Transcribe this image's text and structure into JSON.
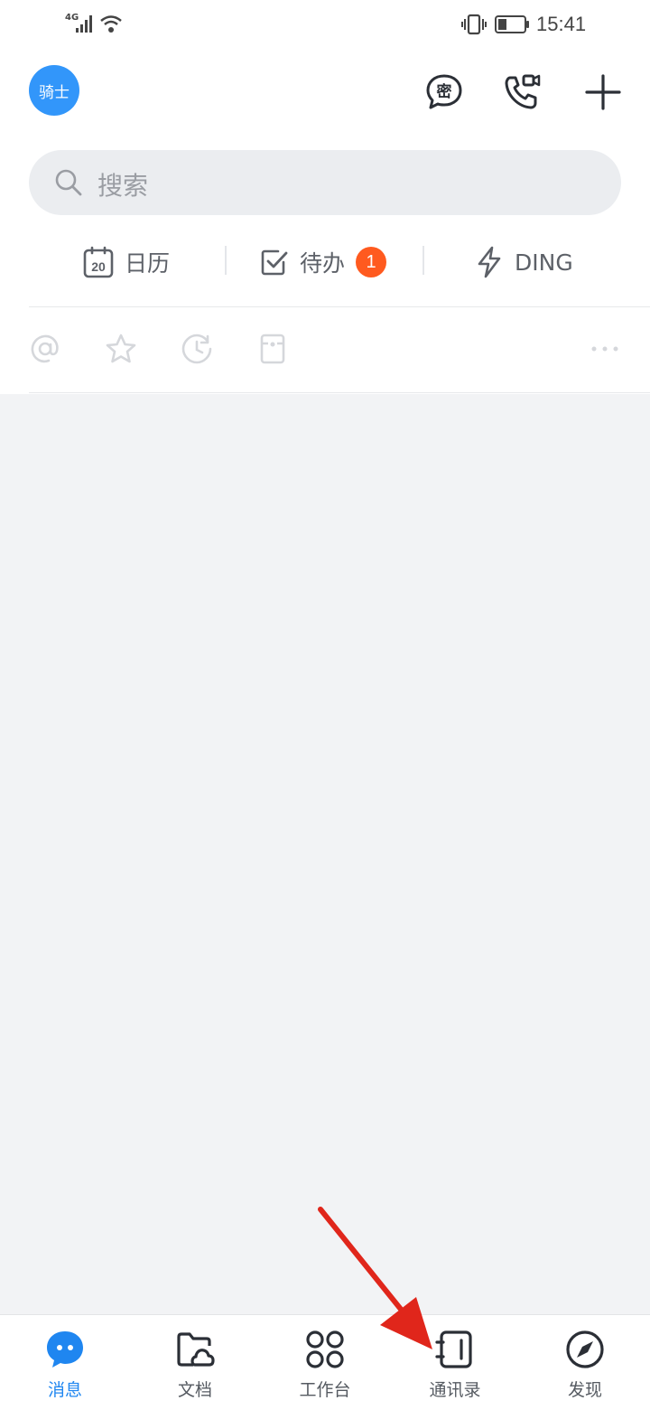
{
  "status_bar": {
    "network": "4G",
    "time": "15:41"
  },
  "header": {
    "avatar_text": "骑士",
    "icons": [
      "secret-chat-icon",
      "video-call-icon",
      "plus-icon"
    ]
  },
  "search": {
    "placeholder": "搜索"
  },
  "quick_actions": [
    {
      "label": "日历",
      "icon": "calendar-icon",
      "calendar_day": "20"
    },
    {
      "label": "待办",
      "icon": "checkbox-icon",
      "badge": "1"
    },
    {
      "label": "DING",
      "icon": "lightning-icon"
    }
  ],
  "filters": [
    "at-mention-icon",
    "star-icon",
    "clock-icon",
    "receipt-icon",
    "more-icon"
  ],
  "tabbar": {
    "items": [
      {
        "label": "消息",
        "icon": "message-icon",
        "active": true
      },
      {
        "label": "文档",
        "icon": "folder-cloud-icon",
        "active": false
      },
      {
        "label": "工作台",
        "icon": "workbench-icon",
        "active": false
      },
      {
        "label": "通讯录",
        "icon": "contacts-icon",
        "active": false
      },
      {
        "label": "发现",
        "icon": "compass-icon",
        "active": false
      }
    ]
  },
  "colors": {
    "accent": "#1f86f0",
    "badge": "#ff5a1f",
    "annotation_arrow": "#e0261b"
  }
}
